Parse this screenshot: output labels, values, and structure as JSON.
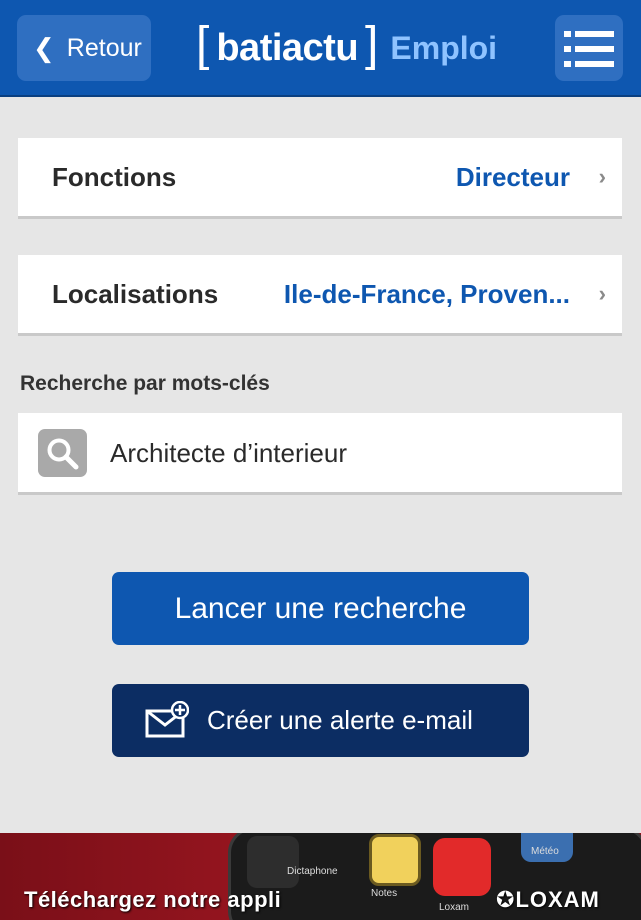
{
  "header": {
    "back_label": "Retour",
    "logo_name": "batiactu",
    "logo_section": "Emploi",
    "colors": {
      "bar": "#0e57b0",
      "button": "#2f6fc1",
      "section_text": "#8fc3ff"
    }
  },
  "filters": {
    "fonctions": {
      "label": "Fonctions",
      "value": "Directeur"
    },
    "localisations": {
      "label": "Localisations",
      "value": "Ile-de-France, Proven..."
    }
  },
  "keywords": {
    "label": "Recherche par mots-clés",
    "value": "Architecte d’interieur"
  },
  "actions": {
    "search_label": "Lancer une recherche",
    "alert_label": "Créer une alerte e-mail",
    "colors": {
      "search": "#0e57b0",
      "alert": "#0c2d63"
    }
  },
  "banner": {
    "text": "Téléchargez notre appli",
    "brand": "LOXAM",
    "app_labels": [
      "Dictaphone",
      "Notes",
      "Loxam",
      "Météo"
    ]
  }
}
